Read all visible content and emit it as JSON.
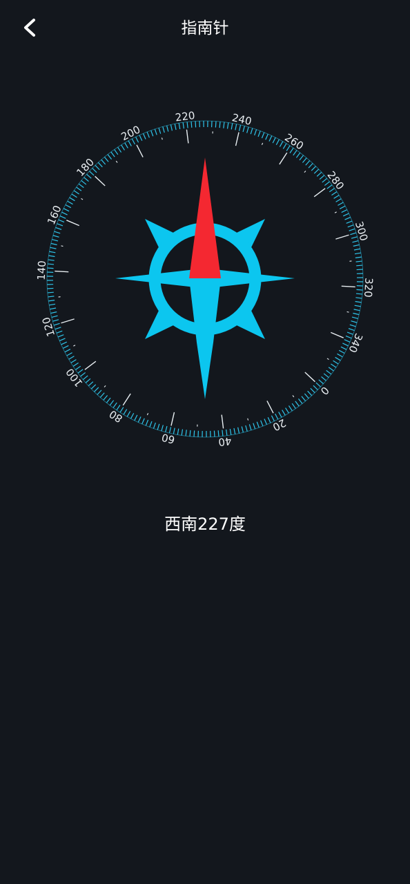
{
  "header": {
    "title": "指南针",
    "back_icon": "chevron-left-icon"
  },
  "compass": {
    "dial_rotation_deg": -227,
    "scale_labels": [
      "0",
      "20",
      "40",
      "60",
      "80",
      "100",
      "120",
      "140",
      "160",
      "180",
      "200",
      "220",
      "240",
      "260",
      "280",
      "300",
      "320",
      "340"
    ],
    "colors": {
      "background": "#13171d",
      "ring_ticks": "#2ec6ec",
      "major_ticks": "#e8eef2",
      "label": "#e9eef2",
      "rose": "#0cc6ef",
      "north_needle": "#f42831",
      "south_needle": "#0cc6ef"
    }
  },
  "readout": {
    "text": "西南227度"
  }
}
